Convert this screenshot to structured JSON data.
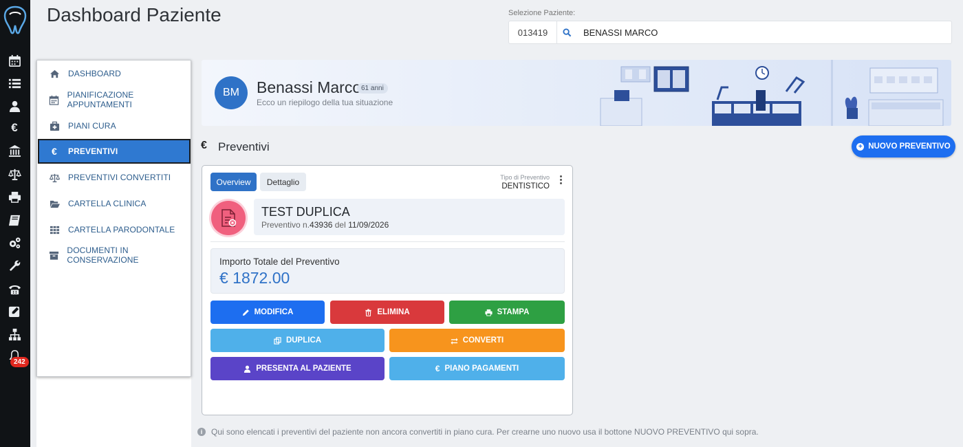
{
  "header": {
    "title": "Dashboard Paziente",
    "selection_label": "Selezione Paziente:",
    "patient_code": "013419",
    "patient_name": "BENASSI MARCO"
  },
  "rail": {
    "icons": [
      "calendar-icon",
      "list-icon",
      "user-doctor-icon",
      "euro-icon",
      "bank-icon",
      "balance-scale-icon",
      "print-icon",
      "book-icon",
      "cogs-icon",
      "wrench-icon",
      "phone-icon",
      "edit-icon",
      "sitemap-icon",
      "bell-icon"
    ],
    "notification_count": "242"
  },
  "menu": {
    "items": [
      {
        "label": "DASHBOARD",
        "icon": "home-icon"
      },
      {
        "label": "PIANIFICAZIONE APPUNTAMENTI",
        "icon": "calendar-icon"
      },
      {
        "label": "PIANI CURA",
        "icon": "medkit-icon"
      },
      {
        "label": "PREVENTIVI",
        "icon": "euro-icon",
        "active": true
      },
      {
        "label": "PREVENTIVI CONVERTITI",
        "icon": "balance-scale-icon"
      },
      {
        "label": "CARTELLA CLINICA",
        "icon": "folder-open-icon"
      },
      {
        "label": "CARTELLA PARODONTALE",
        "icon": "grid-icon"
      },
      {
        "label": "DOCUMENTI IN CONSERVAZIONE",
        "icon": "archive-icon"
      }
    ]
  },
  "patient": {
    "initials": "BM",
    "name": "Benassi Marco",
    "age": "61 anni",
    "subtitle": "Ecco un riepilogo della tua situazione"
  },
  "section": {
    "euro_symbol": "€",
    "title": "Preventivi",
    "new_button": "NUOVO PREVENTIVO"
  },
  "card": {
    "tabs": {
      "overview": "Overview",
      "dettaglio": "Dettaglio"
    },
    "tipo_label": "Tipo di Preventivo",
    "tipo_value": "DENTISTICO",
    "preventivo_title": "TEST DUPLICA",
    "preventivo_prefix": "Preventivo n.",
    "preventivo_number": "43936",
    "preventivo_del": " del ",
    "preventivo_date": "11/09/2026",
    "amount_label": "Importo Totale del Preventivo",
    "amount_value": "€ 1872.00",
    "buttons": {
      "modifica": "MODIFICA",
      "elimina": "ELIMINA",
      "stampa": "STAMPA",
      "duplica": "DUPLICA",
      "converti": "CONVERTI",
      "presenta": "PRESENTA AL PAZIENTE",
      "piano": "PIANO PAGAMENTI"
    }
  },
  "footer_note": "Qui sono elencati i preventivi del paziente non ancora convertiti in piano cura. Per crearne uno nuovo usa il bottone NUOVO PREVENTIVO qui sopra.",
  "colors": {
    "primary": "#1d6ef0",
    "active_menu": "#2f79d1",
    "danger": "#d9393c",
    "success": "#2ea043",
    "info": "#4fb0ea",
    "warning": "#f7941d",
    "purple": "#5a44c8",
    "rail": "#101316"
  }
}
